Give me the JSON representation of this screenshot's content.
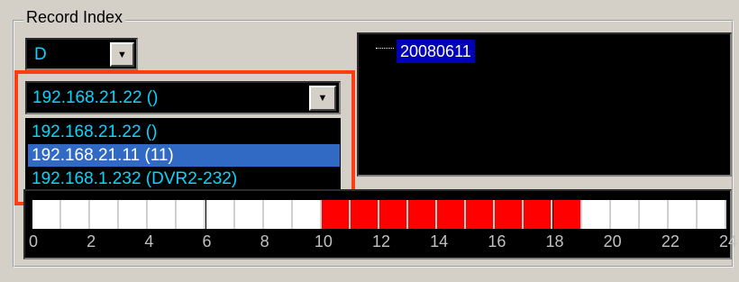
{
  "group_title": "Record Index",
  "drive": {
    "value": "D"
  },
  "ip_select": {
    "value": "192.168.21.22 ()",
    "options": [
      {
        "label": "192.168.21.22 ()",
        "selected": false
      },
      {
        "label": "192.168.21.11 (11)",
        "selected": true
      },
      {
        "label": "192.168.1.232 (DVR2-232)",
        "selected": false
      }
    ]
  },
  "date_tree": {
    "items": [
      "20080611"
    ]
  },
  "timeline": {
    "recorded_hours": [
      10,
      11,
      12,
      13,
      14,
      15,
      16,
      17,
      18
    ],
    "tick_labels": [
      "0",
      "2",
      "4",
      "6",
      "8",
      "10",
      "12",
      "14",
      "16",
      "18",
      "20",
      "22",
      "24"
    ],
    "colors": {
      "recorded": "#ff0000",
      "empty": "#ffffff"
    }
  },
  "colors": {
    "highlight": "#ff3c12",
    "text_cyan": "#00d7ff",
    "selection": "#316ac5"
  }
}
